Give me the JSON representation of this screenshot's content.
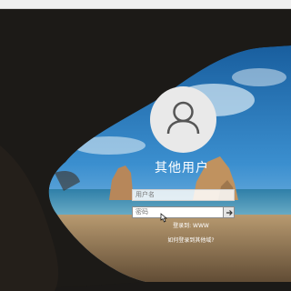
{
  "login": {
    "username": "其他用户",
    "username_placeholder": "用户名",
    "password_placeholder": "密码",
    "sign_in_to": "登录到: WWW",
    "how_sign_in_link": "如何登录到其他域?"
  },
  "icons": {
    "avatar": "user-silhouette-icon",
    "submit": "arrow-right-icon",
    "cursor": "mouse-pointer-icon"
  },
  "colors": {
    "avatar_bg": "#e9e9e9",
    "avatar_figure": "#555555",
    "text": "#ffffff"
  }
}
